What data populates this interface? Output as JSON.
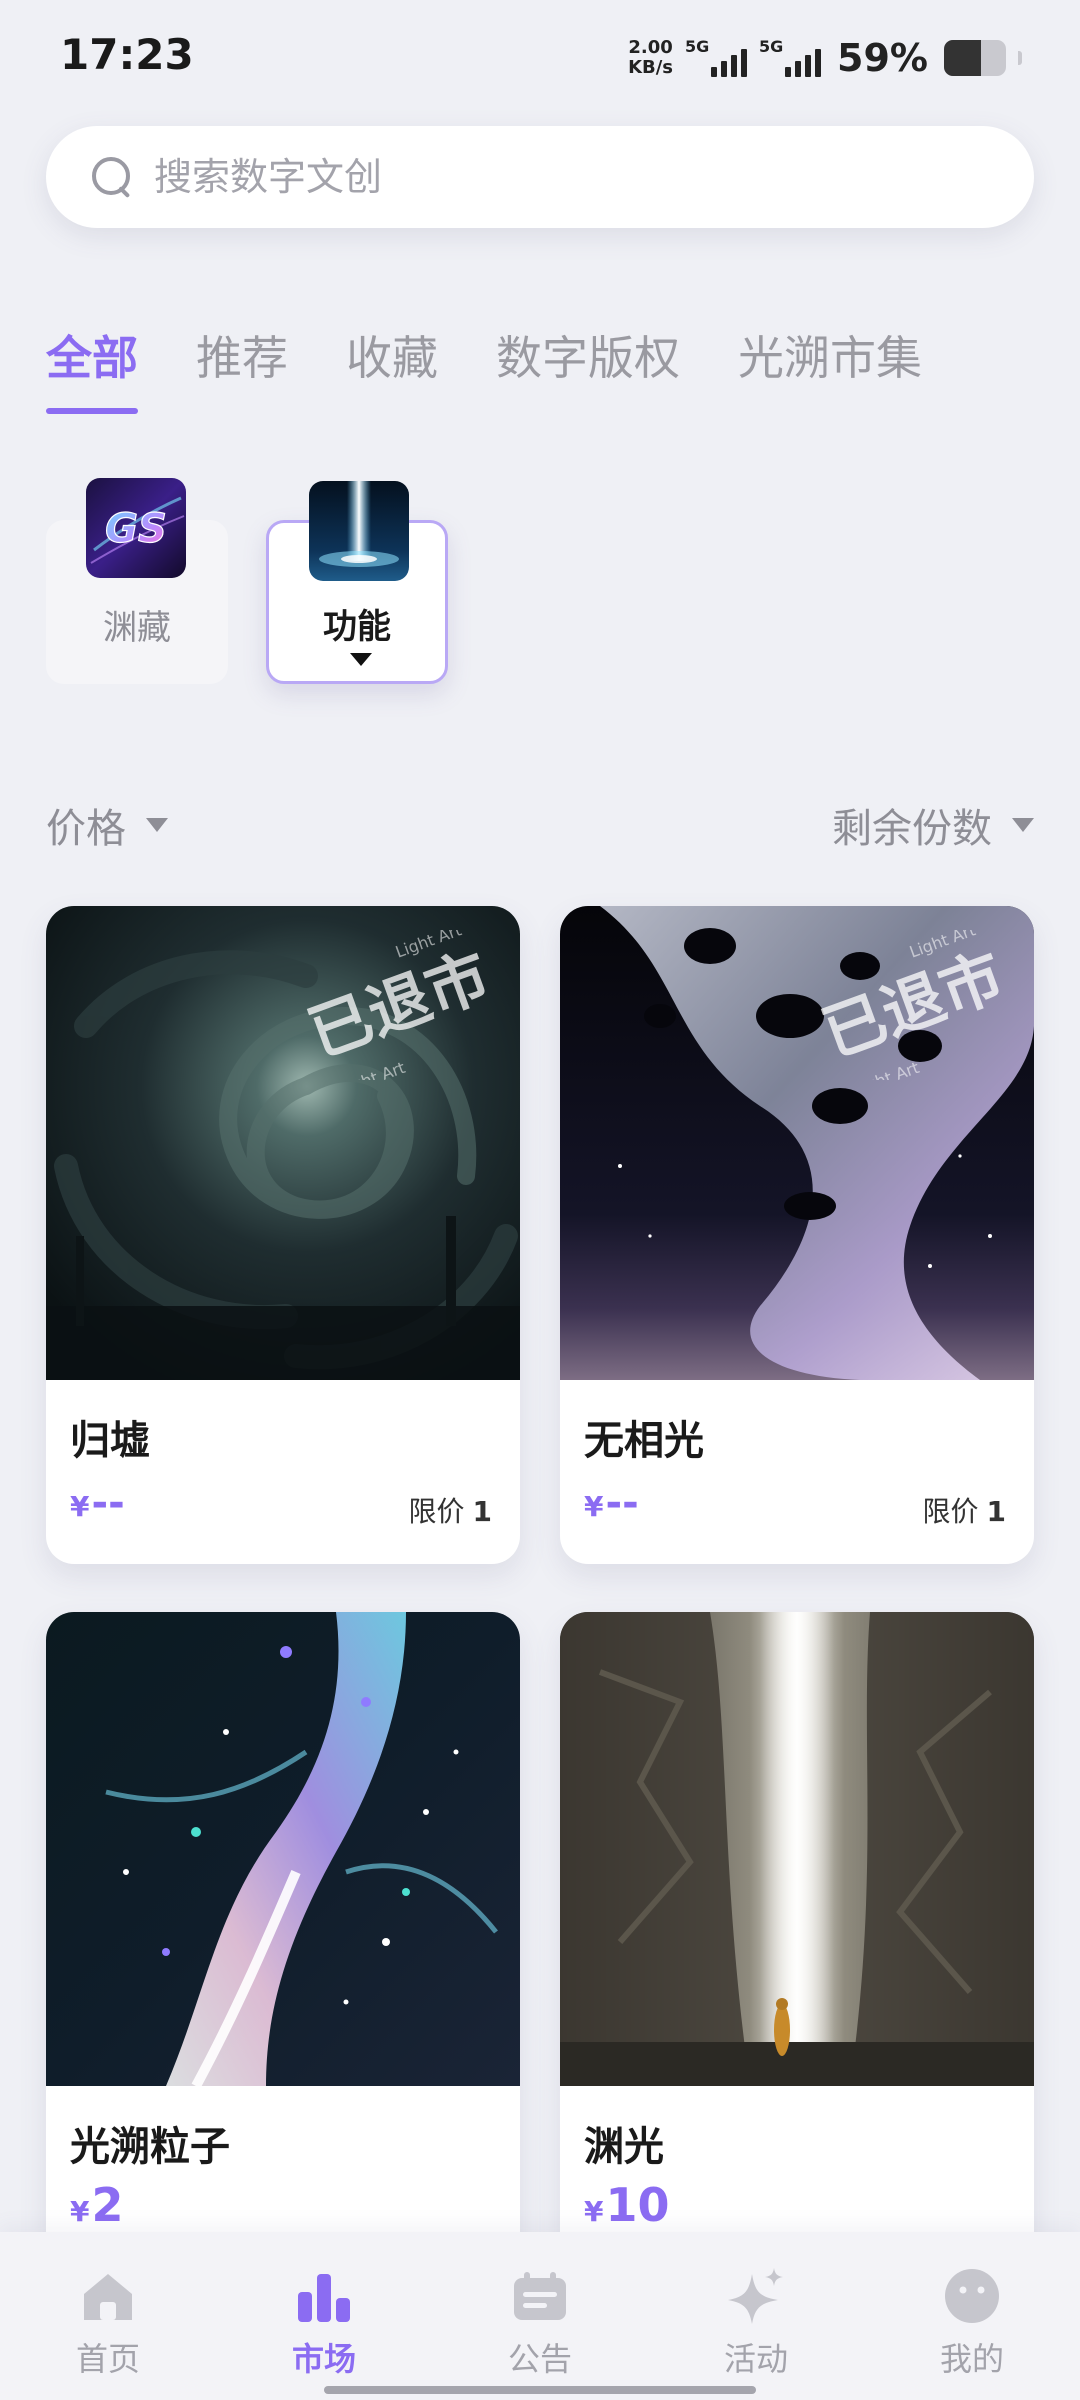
{
  "status_bar": {
    "time": "17:23",
    "net_speed_value": "2.00",
    "net_speed_unit": "KB/s",
    "signal_tag_1": "5G",
    "signal_tag_2": "5G",
    "battery_percent": "59%",
    "battery_level": 0.59
  },
  "search": {
    "placeholder": "搜索数字文创",
    "value": ""
  },
  "tabs": [
    {
      "label": "全部",
      "active": true
    },
    {
      "label": "推荐",
      "active": false
    },
    {
      "label": "收藏",
      "active": false
    },
    {
      "label": "数字版权",
      "active": false
    },
    {
      "label": "光溯市集",
      "active": false
    }
  ],
  "categories": [
    {
      "label": "渊藏",
      "selected": false,
      "icon": "gs-logo-icon"
    },
    {
      "label": "功能",
      "selected": true,
      "icon": "light-beam-icon"
    }
  ],
  "sort": {
    "left_label": "价格",
    "right_label": "剩余份数"
  },
  "products": [
    {
      "title": "归墟",
      "currency": "¥",
      "price": "--",
      "limit_label": "限价",
      "limit_value": "1",
      "stamp_text": "已退市",
      "stamp_ring": "Light Art"
    },
    {
      "title": "无相光",
      "currency": "¥",
      "price": "--",
      "limit_label": "限价",
      "limit_value": "1",
      "stamp_text": "已退市",
      "stamp_ring": "Light Art"
    },
    {
      "title": "光溯粒子",
      "currency": "¥",
      "price": "2"
    },
    {
      "title": "渊光",
      "currency": "¥",
      "price": "10"
    }
  ],
  "bottom_nav": [
    {
      "label": "首页",
      "icon": "home-icon",
      "active": false
    },
    {
      "label": "市场",
      "icon": "market-chart-icon",
      "active": true
    },
    {
      "label": "公告",
      "icon": "notice-icon",
      "active": false
    },
    {
      "label": "活动",
      "icon": "sparkle-icon",
      "active": false
    },
    {
      "label": "我的",
      "icon": "profile-face-icon",
      "active": false
    }
  ],
  "colors": {
    "accent": "#8b6cf2",
    "background": "#eff0f5",
    "muted_text": "#9a9aa1"
  }
}
